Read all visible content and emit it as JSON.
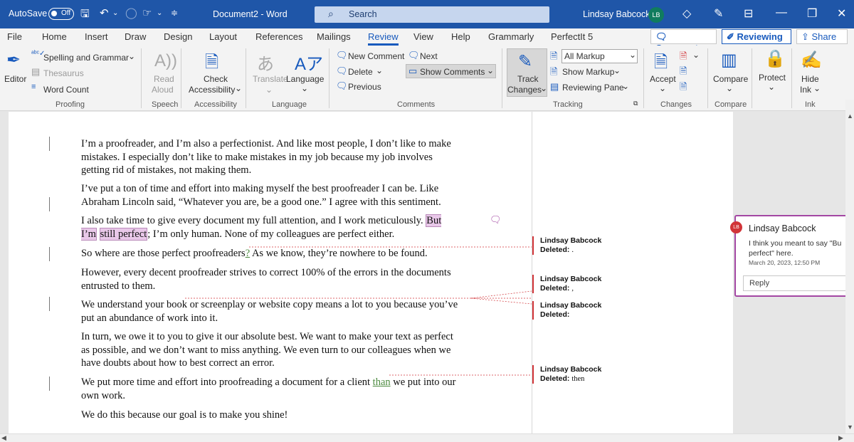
{
  "titlebar": {
    "autosave_label": "AutoSave",
    "autosave_state": "Off",
    "document_title": "Document2 - Word",
    "search_placeholder": "Search",
    "user_name": "Lindsay Babcock",
    "user_initials": "LB"
  },
  "tabs": [
    "File",
    "Home",
    "Insert",
    "Draw",
    "Design",
    "Layout",
    "References",
    "Mailings",
    "Review",
    "View",
    "Help",
    "Grammarly",
    "PerfectIt 5"
  ],
  "active_tab": "Review",
  "header_buttons": {
    "comments": "Comments",
    "reviewing": "Reviewing",
    "share": "Share"
  },
  "ribbon": {
    "proofing": {
      "editor": "Editor",
      "spelling": "Spelling and Grammar",
      "thesaurus": "Thesaurus",
      "word_count": "Word Count",
      "group": "Proofing"
    },
    "speech": {
      "read_aloud_1": "Read",
      "read_aloud_2": "Aloud",
      "group": "Speech"
    },
    "accessibility": {
      "check_1": "Check",
      "check_2": "Accessibility",
      "group": "Accessibility"
    },
    "language": {
      "translate": "Translate",
      "language": "Language",
      "group": "Language"
    },
    "comments": {
      "new_comment": "New Comment",
      "next": "Next",
      "delete": "Delete",
      "show_comments": "Show Comments",
      "previous": "Previous",
      "group": "Comments"
    },
    "tracking": {
      "track_1": "Track",
      "track_2": "Changes",
      "all_markup": "All Markup",
      "show_markup": "Show Markup",
      "reviewing_pane": "Reviewing Pane",
      "group": "Tracking"
    },
    "changes": {
      "accept": "Accept",
      "group": "Changes"
    },
    "compare": {
      "compare": "Compare",
      "group": "Compare"
    },
    "protect": {
      "protect": "Protect"
    },
    "ink": {
      "hide_1": "Hide",
      "hide_2": "Ink",
      "group": "Ink"
    }
  },
  "document": {
    "p1": "I’m a proofreader, and I’m also a perfectionist. And like most people, I don’t like to make mistakes. I especially don’t like to make mistakes in my job because my job involves getting rid of mistakes, not making them.",
    "p2": "I’ve put a ton of time and effort into making myself the best proofreader I can be. Like Abraham Lincoln said, “Whatever you are, be a good one.” I agree with this sentiment.",
    "p3_before": "I also take time to give every document my full attention, and I work meticulously. ",
    "p3_highlight_1": "But I’m",
    "p3_highlight_2": "still perfect",
    "p3_after": "; I’m only human. None of my colleagues are perfect either.",
    "p4_before": "So where are those perfect proofreaders",
    "p4_ins": "?",
    "p4_after": " As we know, they’re nowhere to be found.",
    "p5": "However, every decent proofreader strives to correct 100% of the errors in the documents entrusted to them.",
    "p6": "We understand your book or screenplay or website copy means a lot to you because you’ve put an abundance of work into it.",
    "p7": "In turn, we owe it to you to give it our absolute best. We want to make your text as perfect as possible, and we don’t want to miss anything. We even turn to our colleagues when we have doubts about how to best correct an error.",
    "p8_before": "We put more time and effort into proofreading a document for a client ",
    "p8_ins": "than",
    "p8_after": " we put into our own work.",
    "p9": "We do this because our goal is to make you shine!"
  },
  "balloons": [
    {
      "author": "Lindsay Babcock",
      "label": "Deleted:",
      "text": "."
    },
    {
      "author": "Lindsay Babcock",
      "label": "Deleted:",
      "text": ","
    },
    {
      "author": "Lindsay Babcock",
      "label": "Deleted:",
      "text": ""
    },
    {
      "author": "Lindsay Babcock",
      "label": "Deleted:",
      "text": "then"
    }
  ],
  "comment": {
    "initials": "LB",
    "author": "Lindsay Babcock",
    "text_line1": "I think you meant to say \"Bu",
    "text_line2": "perfect\" here.",
    "date": "March 20, 2023, 12:50 PM",
    "reply_placeholder": "Reply"
  },
  "colors": {
    "title_bar": "#1f56a8",
    "accent": "#185abd",
    "deletion_bar": "#d13438",
    "comment_border": "#a347a3",
    "highlight": "#e9c8e9"
  }
}
